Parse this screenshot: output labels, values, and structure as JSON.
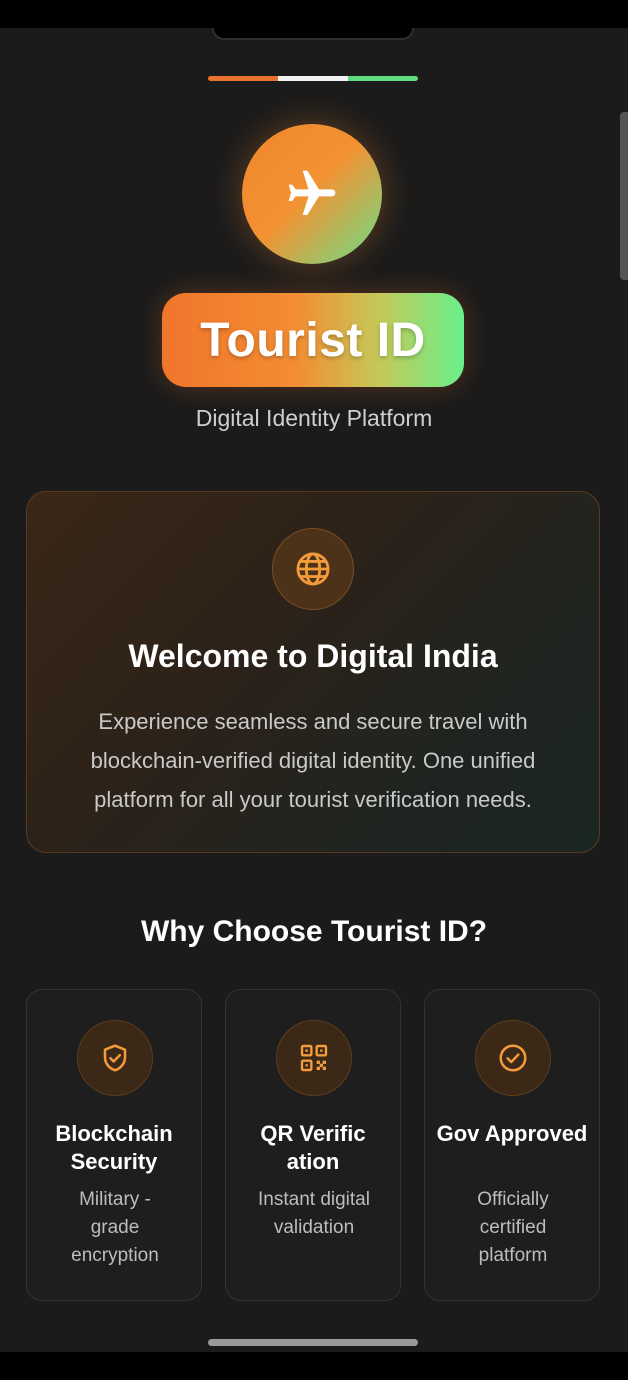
{
  "colors": {
    "saffron": "#f0752c",
    "white": "#f2f2f2",
    "green": "#69e08a",
    "background": "#1b1b1b",
    "icon_accent": "#f39a3a"
  },
  "header": {
    "icon": "airplane-icon",
    "brand": "Tourist ID",
    "tagline": "Digital Identity Platform"
  },
  "welcome": {
    "icon": "globe-icon",
    "title": "Welcome to Digital India",
    "body": "Experience seamless and secure travel with blockchain-verified digital identity. One unified platform for all your tourist verification needs."
  },
  "features": {
    "heading": "Why Choose Tourist ID?",
    "items": [
      {
        "icon": "shield-check-icon",
        "title": "Blockchain Security",
        "desc": "Military -grade encryption"
      },
      {
        "icon": "qr-code-icon",
        "title": "QR Verific ation",
        "desc": "Instant digital validation"
      },
      {
        "icon": "check-circle-icon",
        "title": "Gov Approved",
        "desc": "Officially certified platform"
      }
    ]
  }
}
